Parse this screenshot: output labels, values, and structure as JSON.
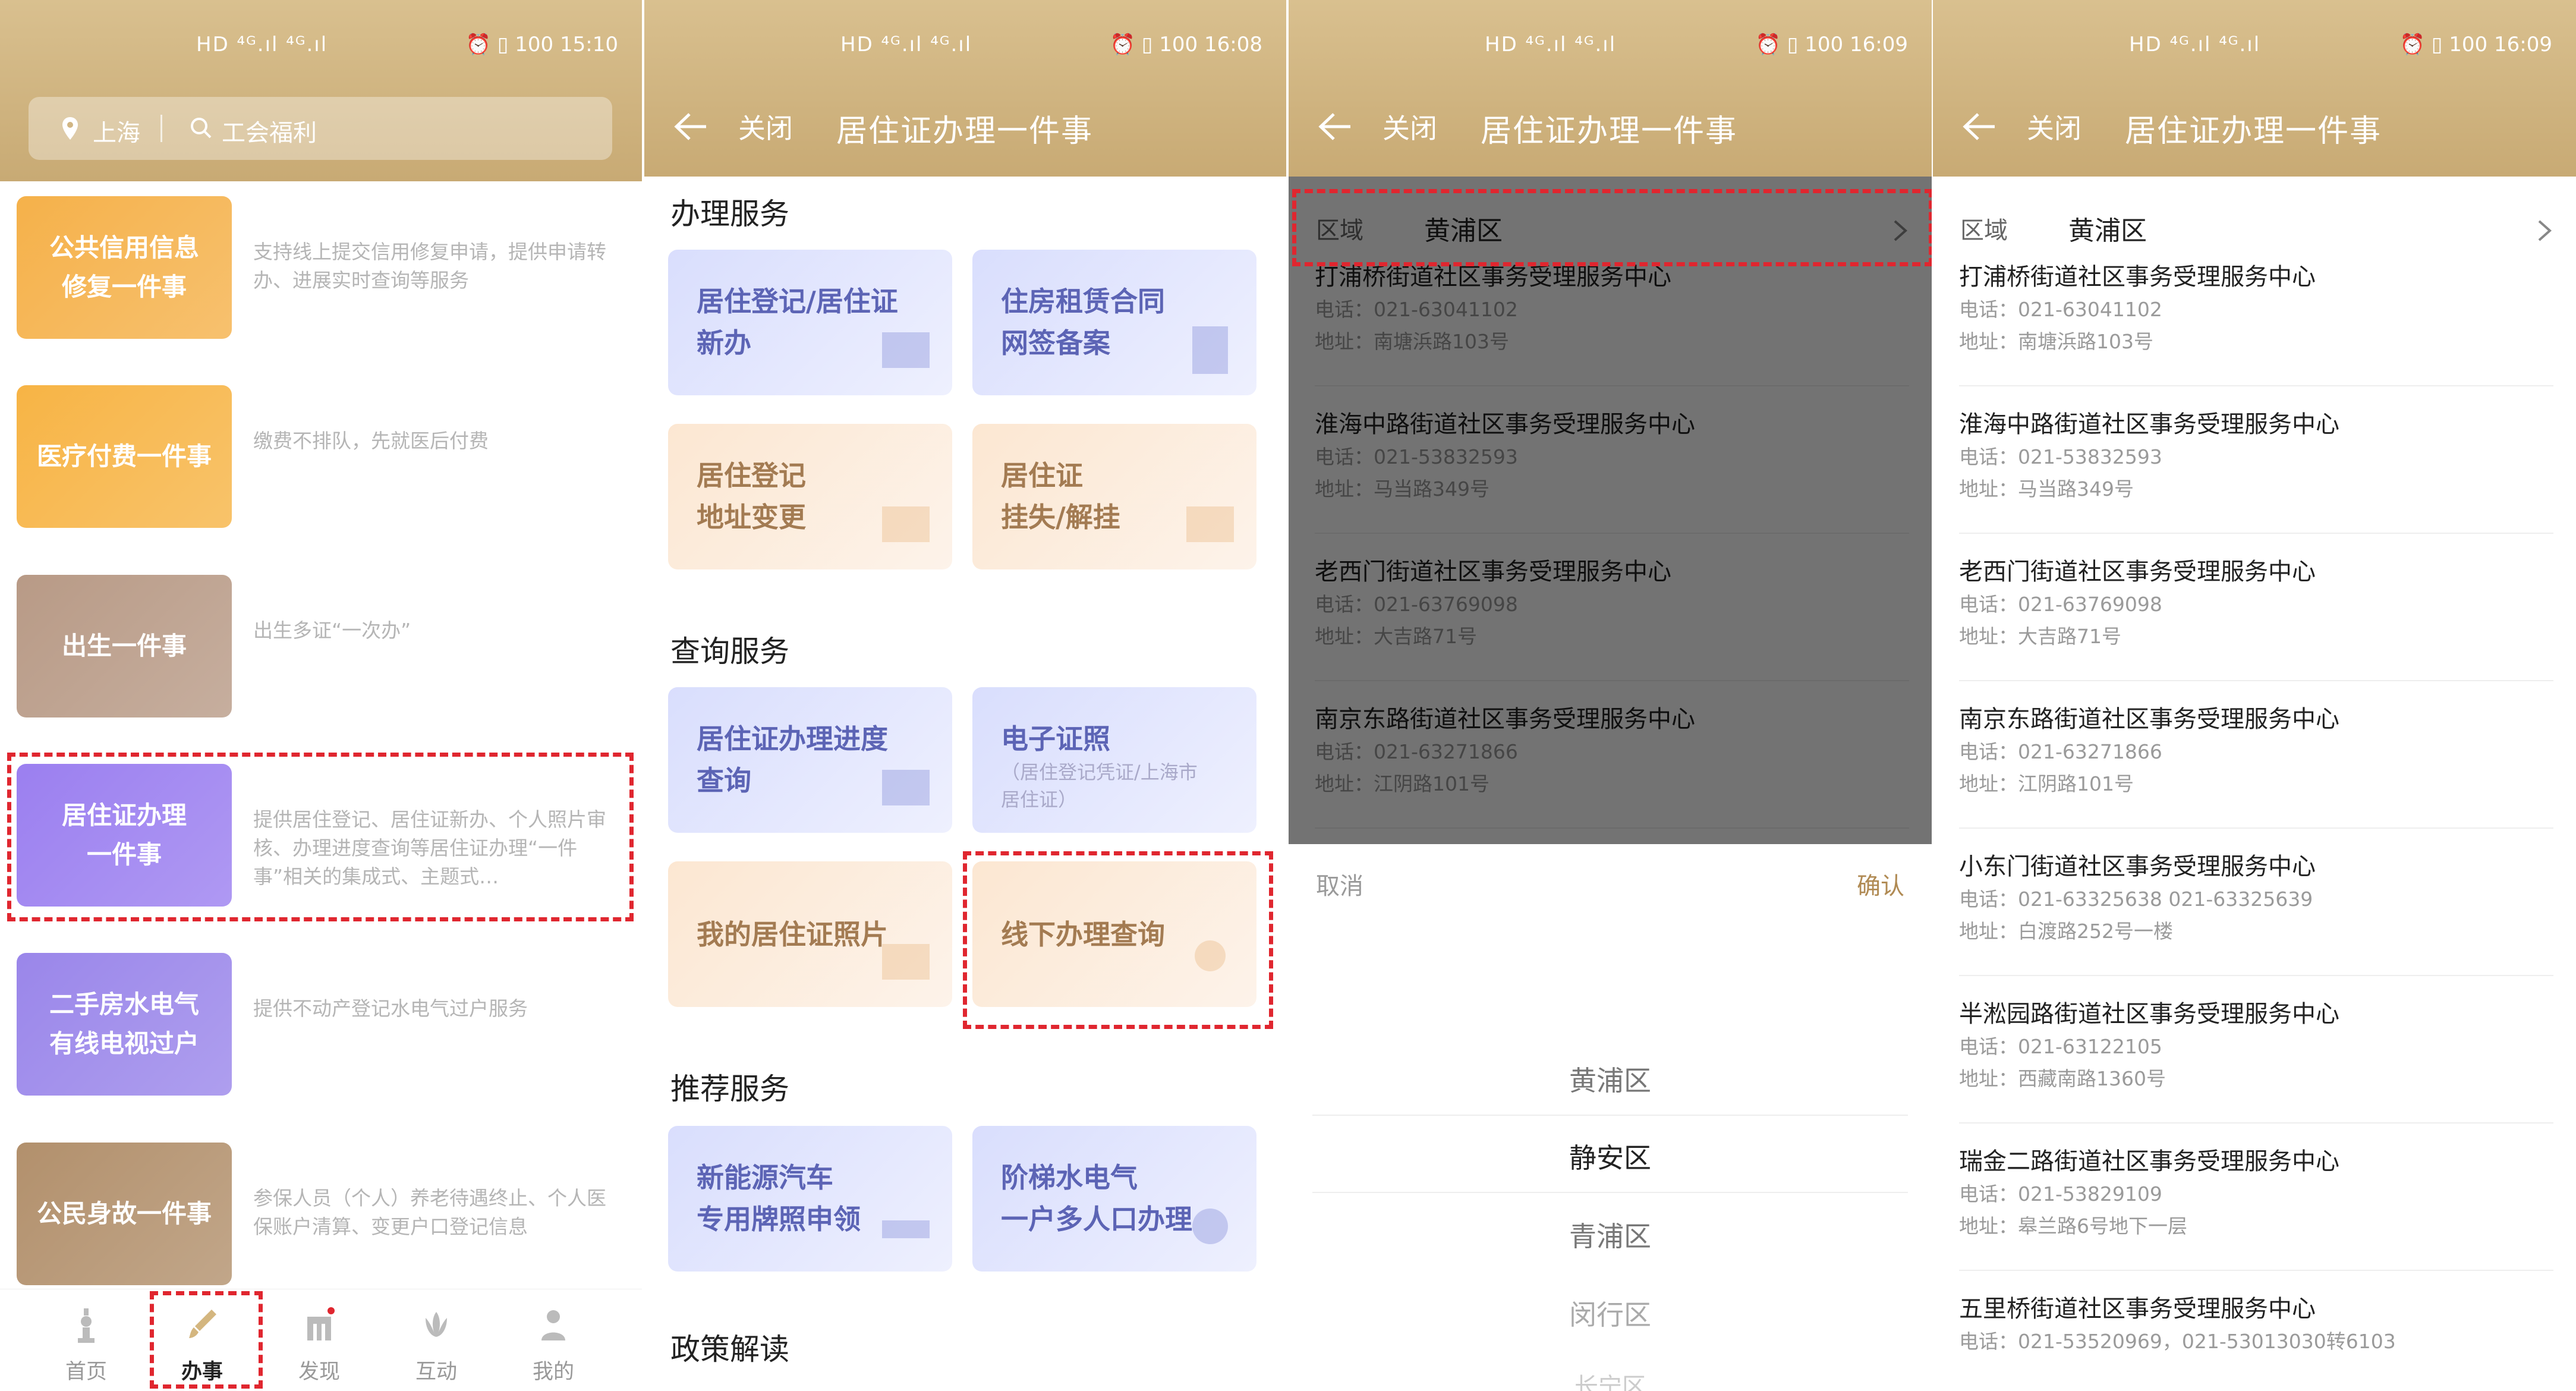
{
  "colors": {
    "gold": "#c8aa74",
    "highlight": "#e0262f"
  },
  "status": {
    "p1_time": "15:10",
    "p2_time": "16:08",
    "p3_time": "16:09",
    "p4_time": "16:09",
    "left_icons": "HD ⁴ᴳ.ıl ⁴ᴳ.ıl",
    "battery": "100"
  },
  "p1": {
    "city": "上海",
    "search": "工会福利",
    "services": [
      {
        "title": "公共信用信息\n修复一件事",
        "desc": "支持线上提交信用修复申请，提供申请转办、进展实时查询等服务",
        "color": "#f5b14a"
      },
      {
        "title": "医疗付费一件事",
        "desc": "缴费不排队，先就医后付费",
        "color": "#f7b445"
      },
      {
        "title": "出生一件事",
        "desc": "出生多证“一次办”",
        "color": "#b89a86"
      },
      {
        "title": "居住证办理\n一件事",
        "desc": "提供居住登记、居住证新办、个人照片审核、办理进度查询等居住证办理“一件事”相关的集成式、主题式…",
        "color": "#9b7ff0"
      },
      {
        "title": "二手房水电气\n有线电视过户",
        "desc": "提供不动产登记水电气过户服务",
        "color": "#9a86ea"
      },
      {
        "title": "公民身故一件事",
        "desc": "参保人员（个人）养老待遇终止、个人医保账户清算、变更户口登记信息",
        "color": "#b2906c"
      }
    ],
    "tabs": [
      "首页",
      "办事",
      "发现",
      "互动",
      "我的"
    ]
  },
  "nav": {
    "close": "关闭",
    "title": "居住证办理一件事"
  },
  "p2": {
    "sections": [
      "办理服务",
      "查询服务",
      "推荐服务",
      "政策解读"
    ],
    "tiles": [
      {
        "l1": "居住登记/居住证",
        "l2": "新办"
      },
      {
        "l1": "住房租赁合同",
        "l2": "网签备案"
      },
      {
        "l1": "居住登记",
        "l2": "地址变更"
      },
      {
        "l1": "居住证",
        "l2": "挂失/解挂"
      },
      {
        "l1": "居住证办理进度",
        "l2": "查询"
      },
      {
        "l1": "电子证照",
        "sub1": "（居住登记凭证/上海市",
        "sub2": "居住证）"
      },
      {
        "l1": "我的居住证照片",
        "l2": ""
      },
      {
        "l1": "线下办理查询",
        "l2": ""
      },
      {
        "l1": "新能源汽车",
        "l2": "专用牌照申领"
      },
      {
        "l1": "阶梯水电气",
        "l2": "一户多人口办理"
      }
    ]
  },
  "region": {
    "label": "区域",
    "value": "黄浦区"
  },
  "picker": {
    "cancel": "取消",
    "confirm": "确认",
    "options": [
      "黄浦区",
      "静安区",
      "青浦区",
      "闵行区",
      "长宁区"
    ]
  },
  "centers": [
    {
      "name": "打浦桥街道社区事务受理服务中心",
      "phone_label": "电话：",
      "phone": "021-63041102",
      "addr_label": "地址：",
      "addr": "南塘浜路103号"
    },
    {
      "name": "淮海中路街道社区事务受理服务中心",
      "phone_label": "电话：",
      "phone": "021-53832593",
      "addr_label": "地址：",
      "addr": "马当路349号"
    },
    {
      "name": "老西门街道社区事务受理服务中心",
      "phone_label": "电话：",
      "phone": "021-63769098",
      "addr_label": "地址：",
      "addr": "大吉路71号"
    },
    {
      "name": "南京东路街道社区事务受理服务中心",
      "phone_label": "电话：",
      "phone": "021-63271866",
      "addr_label": "地址：",
      "addr": "江阴路101号"
    },
    {
      "name": "小东门街道社区事务受理服务中心",
      "phone_label": "电话：",
      "phone": "021-63325638 021-63325639",
      "addr_label": "地址：",
      "addr": "白渡路252号一楼"
    },
    {
      "name": "半淞园路街道社区事务受理服务中心",
      "phone_label": "电话：",
      "phone": "021-63122105",
      "addr_label": "地址：",
      "addr": "西藏南路1360号"
    },
    {
      "name": "瑞金二路街道社区事务受理服务中心",
      "phone_label": "电话：",
      "phone": "021-53829109",
      "addr_label": "地址：",
      "addr": "皋兰路6号地下一层"
    },
    {
      "name": "五里桥街道社区事务受理服务中心",
      "phone_label": "电话：",
      "phone": "021-53520969，021-53013030转6103",
      "addr_label": "地址：",
      "addr": ""
    }
  ]
}
